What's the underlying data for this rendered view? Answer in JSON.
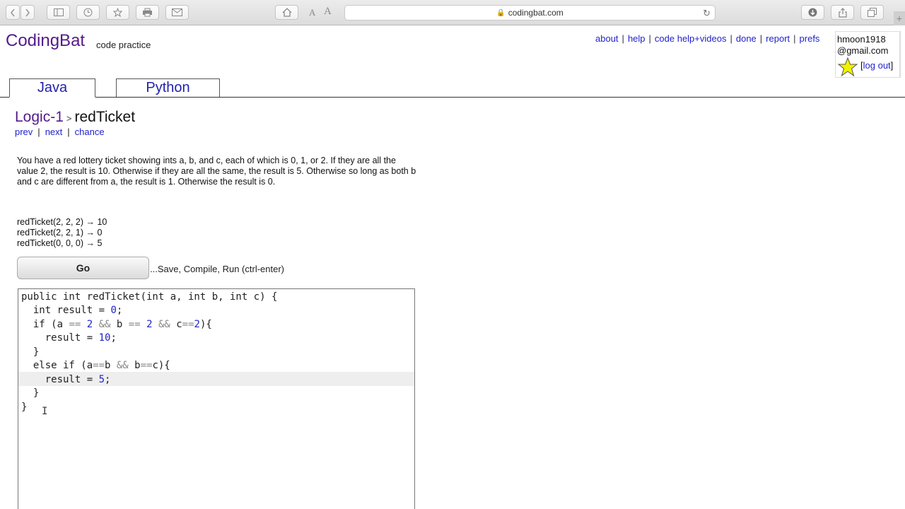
{
  "browser": {
    "url": "codingbat.com",
    "font_small": "A",
    "font_large": "A"
  },
  "header": {
    "logo": "CodingBat",
    "logo_sub": "code practice",
    "links": [
      "about",
      "help",
      "code help+videos",
      "done",
      "report",
      "prefs"
    ],
    "user_line1": "hmoon1918",
    "user_line2": "@gmail.com",
    "logout": "log out",
    "logout_bracket_open": "[",
    "logout_bracket_close": "]"
  },
  "tabs": {
    "java": "Java",
    "python": "Python"
  },
  "breadcrumb": {
    "section": "Logic-1",
    "separator": ">",
    "problem": "redTicket"
  },
  "nav": {
    "prev": "prev",
    "next": "next",
    "chance": "chance",
    "sep": "|"
  },
  "description": "You have a red lottery ticket showing ints a, b, and c, each of which is 0, 1, or 2. If they are all the value 2, the result is 10. Otherwise if they are all the same, the result is 5. Otherwise so long as both b and c are different from a, the result is 1. Otherwise the result is 0.",
  "examples": [
    "redTicket(2, 2, 2) → 10",
    "redTicket(2, 2, 1) → 0",
    "redTicket(0, 0, 0) → 5"
  ],
  "go": {
    "label": "Go",
    "hint": "...Save, Compile, Run (ctrl-enter)"
  },
  "code": [
    "public int redTicket(int a, int b, int c) {",
    "  int result = 0;",
    "  if (a == 2 && b == 2 && c==2){",
    "    result = 10;",
    "  }",
    "  else if (a==b && b==c){",
    "    result = 5;",
    "  }",
    "}"
  ],
  "colors": {
    "logo": "#551a8b",
    "link": "#2222cc",
    "number": "#2222cc",
    "current_line": "#eeeeee"
  }
}
